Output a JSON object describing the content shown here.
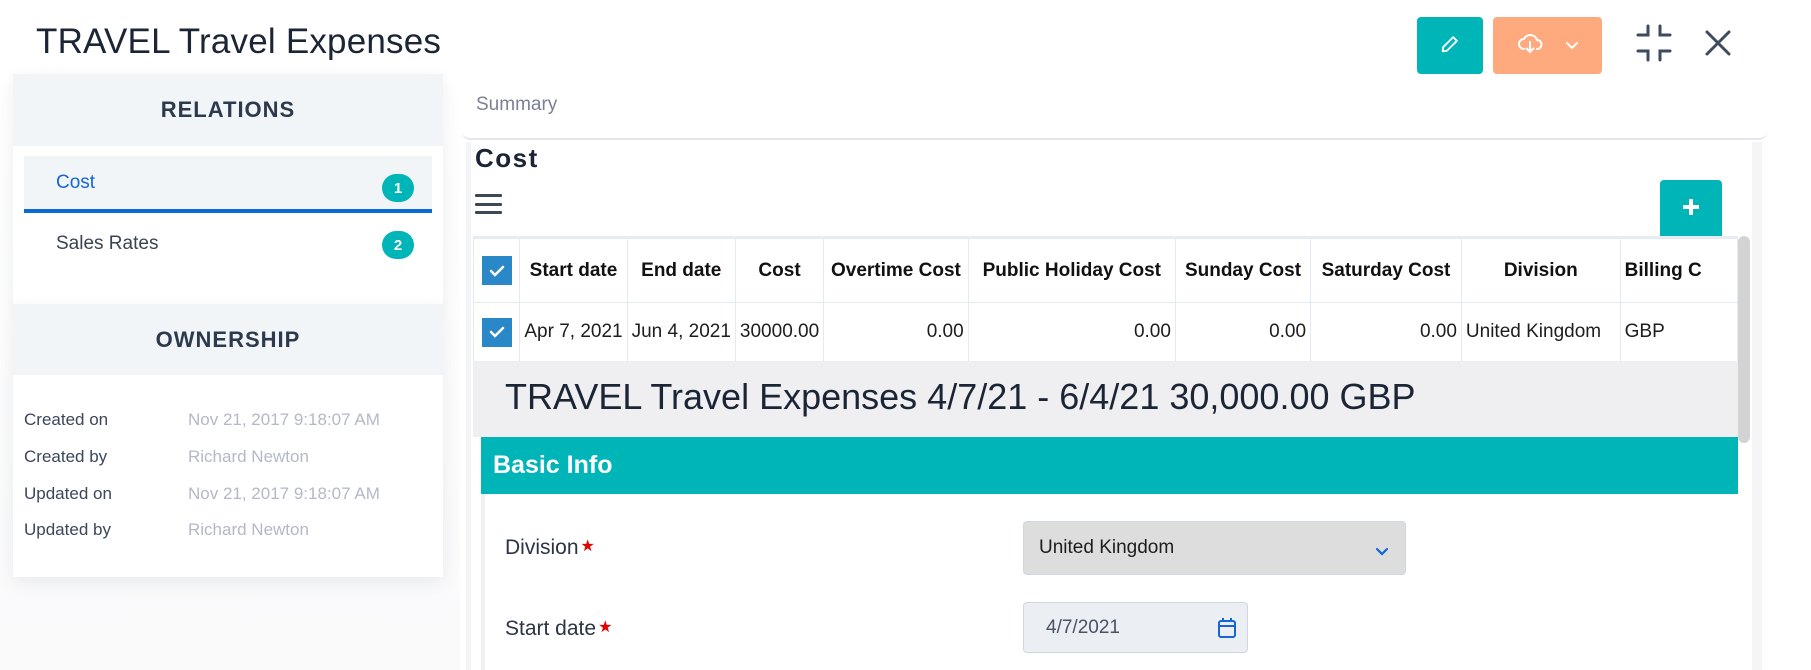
{
  "page": {
    "title": "TRAVEL Travel Expenses"
  },
  "header_actions": {
    "edit_icon": "pencil-icon",
    "download_icon": "cloud-download-icon",
    "download_dropdown_icon": "chevron-down-icon",
    "collapse_icon": "collapse-icon",
    "close_icon": "close-icon"
  },
  "sidebar": {
    "relations": {
      "heading": "RELATIONS",
      "items": [
        {
          "label": "Cost",
          "count": "1",
          "active": true
        },
        {
          "label": "Sales Rates",
          "count": "2",
          "active": false
        }
      ]
    },
    "ownership": {
      "heading": "OWNERSHIP",
      "rows": [
        {
          "label": "Created on",
          "value": "Nov 21, 2017 9:18:07 AM"
        },
        {
          "label": "Created by",
          "value": "Richard Newton"
        },
        {
          "label": "Updated on",
          "value": "Nov 21, 2017 9:18:07 AM"
        },
        {
          "label": "Updated by",
          "value": "Richard Newton"
        }
      ]
    }
  },
  "main": {
    "tabs": [
      {
        "label": "Summary"
      }
    ],
    "section_title": "Cost",
    "menu_icon": "hamburger-menu-icon",
    "add_icon": "plus-icon",
    "table": {
      "columns": [
        "Start date",
        "End date",
        "Cost",
        "Overtime Cost",
        "Public Holiday Cost",
        "Sunday Cost",
        "Saturday Cost",
        "Division",
        "Billing C"
      ],
      "rows": [
        [
          "Apr 7, 2021",
          "Jun 4, 2021",
          "30000.00",
          "0.00",
          "0.00",
          "0.00",
          "0.00",
          "United Kingdom",
          "GBP"
        ]
      ],
      "header_checked": true,
      "row_checked": [
        true
      ]
    },
    "record": {
      "title": "TRAVEL Travel Expenses 4/7/21 - 6/4/21 30,000.00 GBP",
      "section": "Basic Info",
      "fields": [
        {
          "label": "Division",
          "required": true,
          "value": "United Kingdom",
          "type": "select"
        },
        {
          "label": "Start date",
          "required": true,
          "value": "4/7/2021",
          "type": "date"
        }
      ]
    }
  },
  "colors": {
    "accent_teal": "#00b5b8",
    "download_orange": "#ffa97e",
    "active_blue": "#0a6bd6",
    "checkbox_blue": "#2a88c9",
    "required_red": "#e30000"
  }
}
